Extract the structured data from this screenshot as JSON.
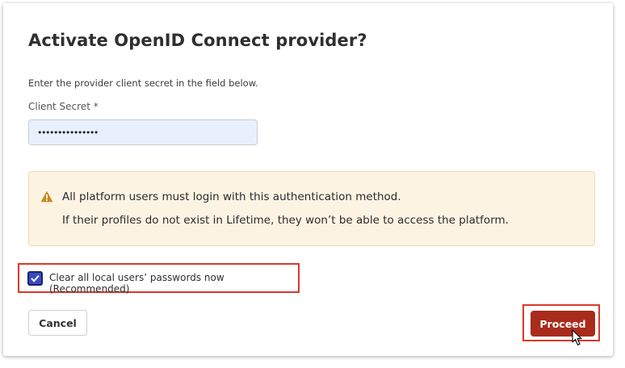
{
  "dialog": {
    "title": "Activate OpenID Connect provider?",
    "instructions": "Enter the provider client secret in the field below."
  },
  "client_secret": {
    "label": "Client Secret *",
    "value": "•••••••••••••••"
  },
  "warning": {
    "icon": "warning-triangle-icon",
    "line1": "All platform users must login with this authentication method.",
    "line2": "If their profiles do not exist in Lifetime, they won’t be able to access the platform."
  },
  "clear_passwords": {
    "checked": true,
    "label": "Clear all local users’ passwords now (Recommended)"
  },
  "buttons": {
    "cancel": "Cancel",
    "proceed": "Proceed"
  },
  "colors": {
    "proceed_bg": "#a92b1c",
    "checkbox_bg": "#3949c6",
    "warning_bg": "#fcf3e3",
    "warning_icon": "#c78a1e",
    "highlight": "#d9382a",
    "input_bg": "#e8f0fe"
  }
}
